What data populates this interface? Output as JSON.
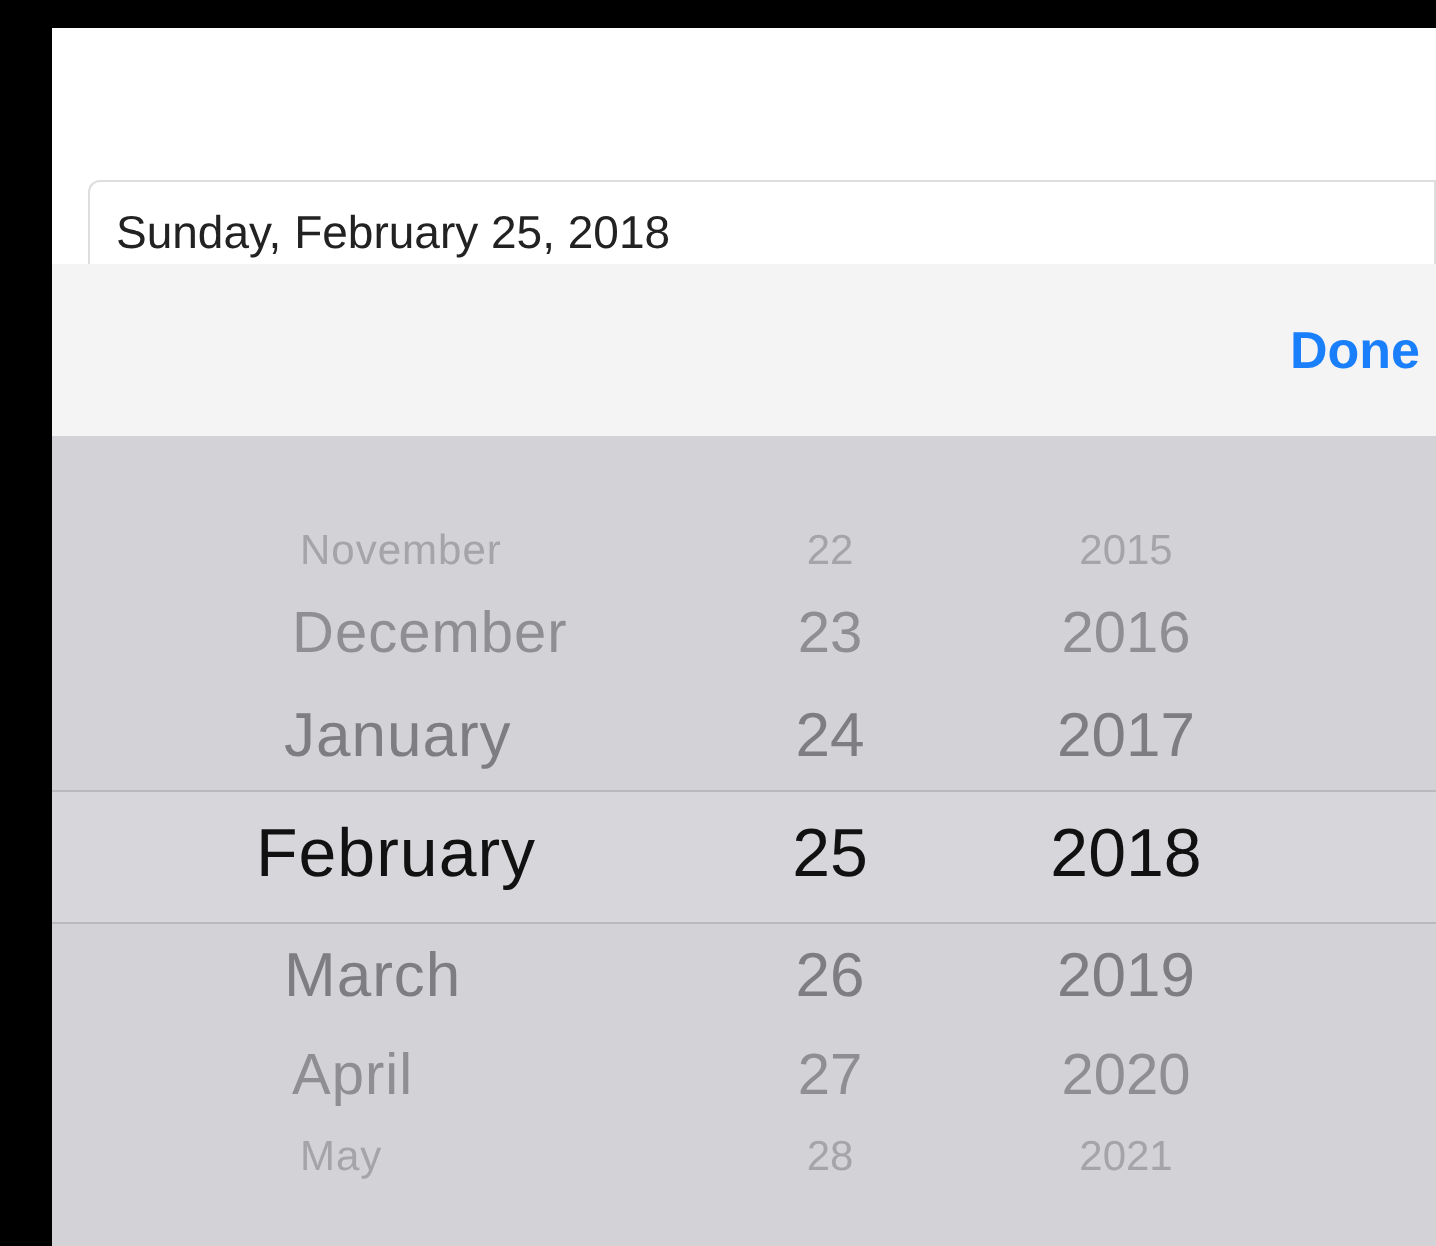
{
  "date_field": {
    "value": "Sunday, February 25, 2018"
  },
  "toolbar": {
    "done_button": "Done"
  },
  "picker": {
    "columns": [
      {
        "kind": "month",
        "items": [
          {
            "label": "November",
            "selected": false
          },
          {
            "label": "December",
            "selected": false
          },
          {
            "label": "January",
            "selected": false
          },
          {
            "label": "February",
            "selected": true
          },
          {
            "label": "March",
            "selected": false
          },
          {
            "label": "April",
            "selected": false
          },
          {
            "label": "May",
            "selected": false
          }
        ]
      },
      {
        "kind": "day",
        "items": [
          {
            "label": "22",
            "selected": false
          },
          {
            "label": "23",
            "selected": false
          },
          {
            "label": "24",
            "selected": false
          },
          {
            "label": "25",
            "selected": true
          },
          {
            "label": "26",
            "selected": false
          },
          {
            "label": "27",
            "selected": false
          },
          {
            "label": "28",
            "selected": false
          }
        ]
      },
      {
        "kind": "year",
        "items": [
          {
            "label": "2015",
            "selected": false
          },
          {
            "label": "2016",
            "selected": false
          },
          {
            "label": "2017",
            "selected": false
          },
          {
            "label": "2018",
            "selected": true
          },
          {
            "label": "2019",
            "selected": false
          },
          {
            "label": "2020",
            "selected": false
          },
          {
            "label": "2021",
            "selected": false
          }
        ]
      }
    ]
  }
}
